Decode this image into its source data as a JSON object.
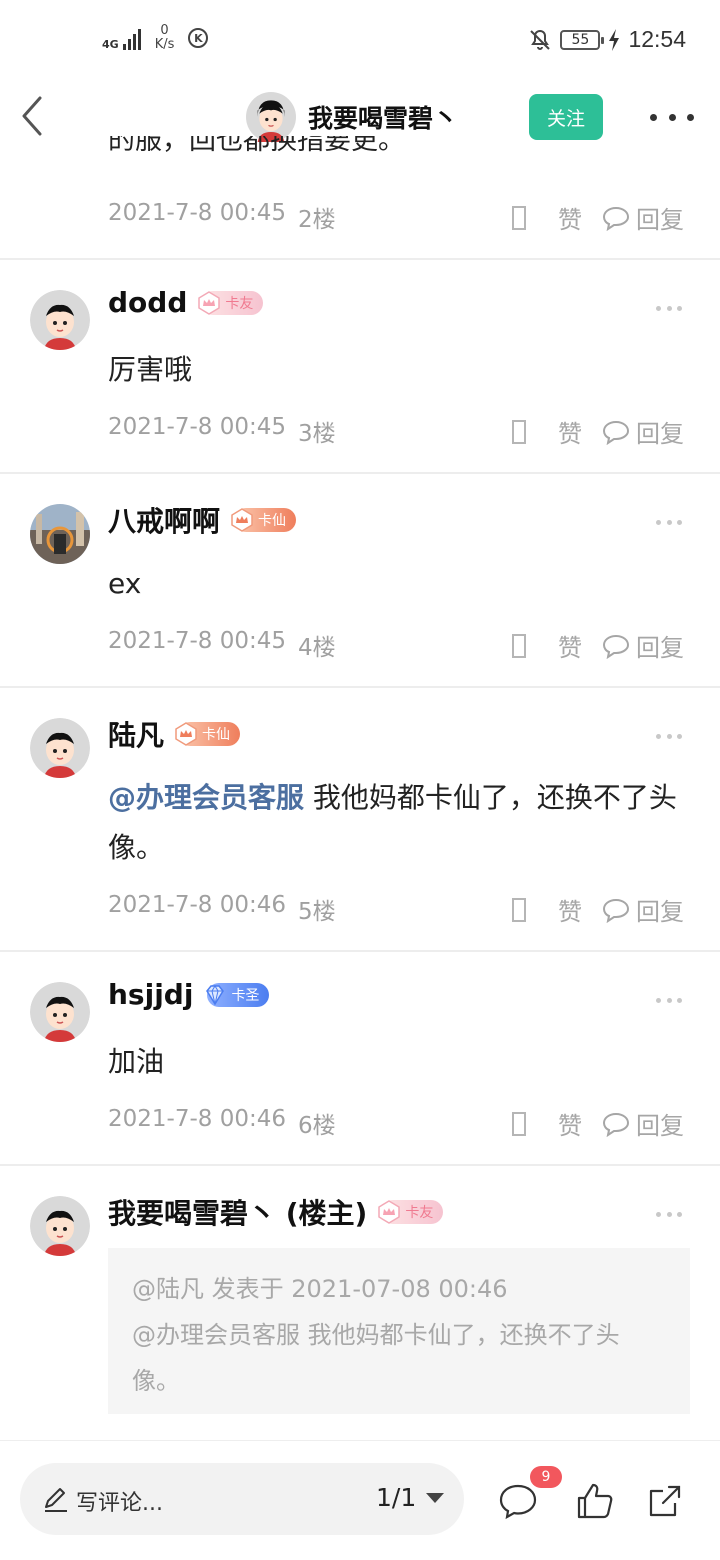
{
  "status_bar": {
    "network": "4G",
    "net_speed_value": "0",
    "net_speed_unit": "K/s",
    "k_icon": "K",
    "battery": "55",
    "time": "12:54"
  },
  "nav": {
    "title": "我要喝雪碧丶",
    "follow_label": "关注"
  },
  "clipped_text": "的服，回也都换指要更。",
  "comments": [
    {
      "name": "",
      "badge": "",
      "body": "",
      "date": "2021-7-8 00:45",
      "floor": "2楼",
      "like": "赞",
      "reply": "回复"
    },
    {
      "name": "dodd",
      "badge": "卡友",
      "body": "厉害哦",
      "date": "2021-7-8 00:45",
      "floor": "3楼",
      "like": "赞",
      "reply": "回复"
    },
    {
      "name": "八戒啊啊",
      "badge": "卡仙",
      "body": "ex",
      "date": "2021-7-8 00:45",
      "floor": "4楼",
      "like": "赞",
      "reply": "回复"
    },
    {
      "name": "陆凡",
      "badge": "卡仙",
      "mention": "@办理会员客服",
      "body": " 我他妈都卡仙了，还换不了头像。",
      "date": "2021-7-8 00:46",
      "floor": "5楼",
      "like": "赞",
      "reply": "回复"
    },
    {
      "name": "hsjjdj",
      "badge": "卡圣",
      "body": "加油",
      "date": "2021-7-8 00:46",
      "floor": "6楼",
      "like": "赞",
      "reply": "回复"
    },
    {
      "name": "我要喝雪碧丶 (楼主)",
      "badge": "卡友"
    }
  ],
  "quote": {
    "header": "@陆凡 发表于 2021-07-08 00:46",
    "body": "@办理会员客服 我他妈都卡仙了，还换不了头像。"
  },
  "bottom_bar": {
    "placeholder": "写评论...",
    "page_indicator": "1/1",
    "comment_count": "9"
  },
  "colors": {
    "accent": "#2dbf97",
    "mention": "#4c6fa0",
    "badge_red": "#f2575d"
  },
  "icons": [
    "back-icon",
    "more-icon",
    "like-icon",
    "reply-icon",
    "pencil-icon",
    "comment-icon",
    "thumb-up-icon",
    "share-icon"
  ]
}
